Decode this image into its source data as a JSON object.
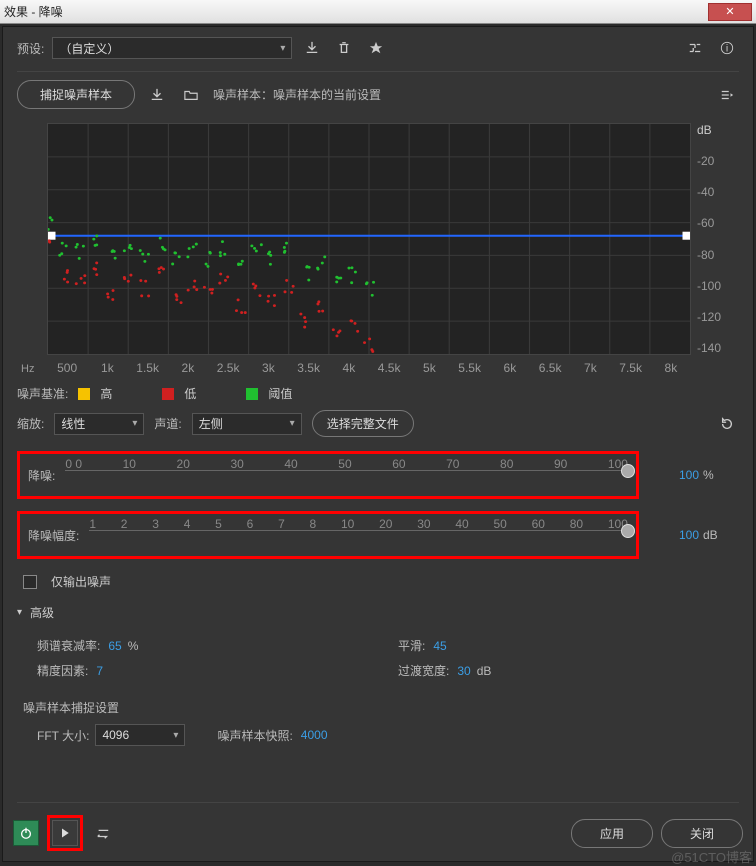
{
  "window": {
    "title": "效果 - 降噪"
  },
  "preset": {
    "label": "预设:",
    "value": "（自定义）"
  },
  "capture": {
    "button": "捕捉噪声样本",
    "sample_label": "噪声样本：噪声样本的当前设置"
  },
  "chart_data": {
    "type": "line",
    "xlabel": "Hz",
    "ylabel": "dB",
    "x_ticks": [
      "500",
      "1k",
      "1.5k",
      "2k",
      "2.5k",
      "3k",
      "3.5k",
      "4k",
      "4.5k",
      "5k",
      "5.5k",
      "6k",
      "6.5k",
      "7k",
      "7.5k",
      "8k"
    ],
    "y_ticks": [
      "dB",
      "-20",
      "-40",
      "-60",
      "-80",
      "-100",
      "-120",
      "-140"
    ],
    "ylim": [
      -140,
      0
    ],
    "threshold_line": -68,
    "series": [
      {
        "name": "高",
        "color": "#f6c200",
        "visible": false
      },
      {
        "name": "低",
        "color": "#d02020",
        "x": [
          0,
          200,
          400,
          600,
          800,
          1000,
          1200,
          1400,
          1600,
          1800,
          2000,
          2200,
          2400,
          2600,
          2800,
          3000,
          3200,
          3400,
          3600,
          3800,
          4000
        ],
        "y": [
          -70,
          -92,
          -96,
          -88,
          -102,
          -96,
          -100,
          -92,
          -105,
          -98,
          -104,
          -96,
          -110,
          -100,
          -108,
          -100,
          -120,
          -112,
          -128,
          -122,
          -135
        ]
      },
      {
        "name": "阈值",
        "color": "#20c030",
        "x": [
          0,
          200,
          400,
          600,
          800,
          1000,
          1200,
          1400,
          1600,
          1800,
          2000,
          2200,
          2400,
          2600,
          2800,
          3000,
          3200,
          3400,
          3600,
          3800,
          4000
        ],
        "y": [
          -60,
          -75,
          -78,
          -72,
          -80,
          -76,
          -80,
          -74,
          -82,
          -78,
          -82,
          -76,
          -85,
          -78,
          -82,
          -76,
          -90,
          -85,
          -95,
          -92,
          -100
        ]
      }
    ]
  },
  "legend": {
    "base_label": "噪声基准:",
    "high": "高",
    "low": "低",
    "threshold": "阈值",
    "high_color": "#f6c200",
    "low_color": "#d02020",
    "threshold_color": "#20c030"
  },
  "scale": {
    "label": "缩放:",
    "value": "线性"
  },
  "channel": {
    "label": "声道:",
    "value": "左侧"
  },
  "select_file": {
    "label": "选择完整文件"
  },
  "sliders": {
    "reduce": {
      "label": "降噪:",
      "ticks": [
        "0 0",
        "10",
        "20",
        "30",
        "40",
        "50",
        "60",
        "70",
        "80",
        "90",
        "100"
      ],
      "value": "100",
      "unit": "%"
    },
    "amount": {
      "label": "降噪幅度:",
      "ticks": [
        "1",
        "2",
        "3",
        "4",
        "5",
        "6",
        "7",
        "8",
        "10",
        "20",
        "30",
        "40",
        "50",
        "60",
        "80",
        "100"
      ],
      "value": "100",
      "unit": "dB"
    }
  },
  "output_noise_only": {
    "label": "仅输出噪声"
  },
  "advanced": {
    "title": "高级",
    "decay": {
      "label": "频谱衰减率:",
      "value": "65",
      "unit": "%"
    },
    "smooth": {
      "label": "平滑:",
      "value": "45"
    },
    "precision": {
      "label": "精度因素:",
      "value": "7"
    },
    "transition": {
      "label": "过渡宽度:",
      "value": "30",
      "unit": "dB"
    },
    "capture_settings": "噪声样本捕捉设置",
    "fft": {
      "label": "FFT 大小:",
      "value": "4096"
    },
    "snapshot": {
      "label": "噪声样本快照:",
      "value": "4000"
    }
  },
  "footer": {
    "apply": "应用",
    "close": "关闭"
  },
  "watermark": "@51CTO博客"
}
